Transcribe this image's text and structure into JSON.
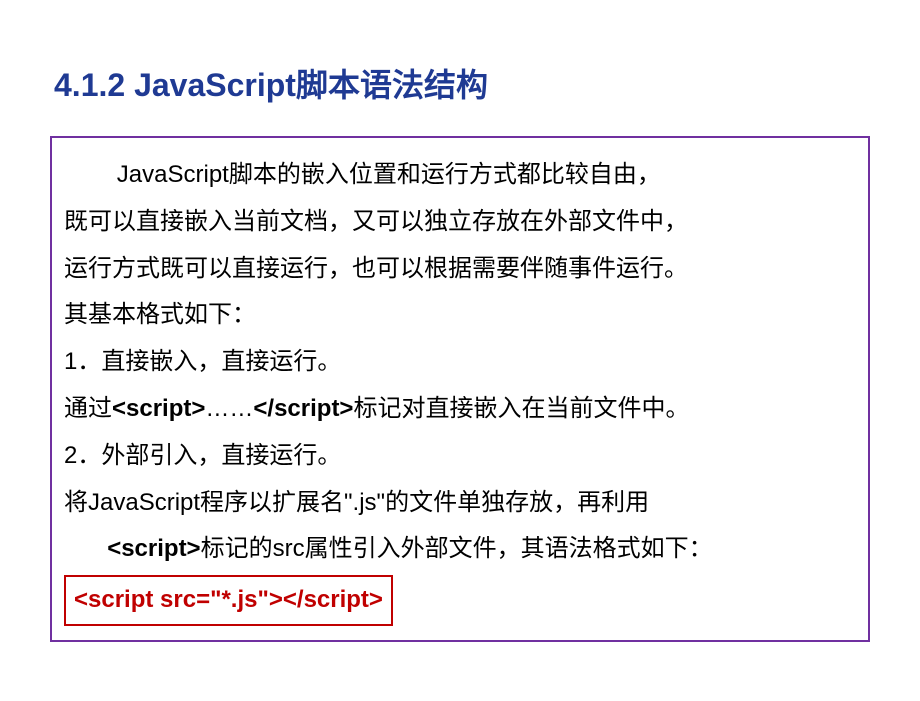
{
  "title": "4.1.2  JavaScript脚本语法结构",
  "content": {
    "p1a": "JavaScript脚本的嵌入位置和运行方式都比较自由，",
    "p1b": "既可以直接嵌入当前文档，又可以独立存放在外部文件中，",
    "p1c": "运行方式既可以直接运行，也可以根据需要伴随事件运行。",
    "p1d": "其基本格式如下：",
    "item1": "1．直接嵌入，直接运行。",
    "item1_desc_a": "通过",
    "item1_desc_tag1": "<script>",
    "item1_desc_mid": "……",
    "item1_desc_tag2": "</script>",
    "item1_desc_b": "标记对直接嵌入在当前文件中。",
    "item2": "2．外部引入，直接运行。",
    "item2_desc_a": "将JavaScript程序以扩展名\".js\"的文件单独存放，再利用",
    "item2_desc_tag": "<script>",
    "item2_desc_b": "标记的src属性引入外部文件，其语法格式如下：",
    "code_example": "<script src=\"*.js\"></script>"
  }
}
